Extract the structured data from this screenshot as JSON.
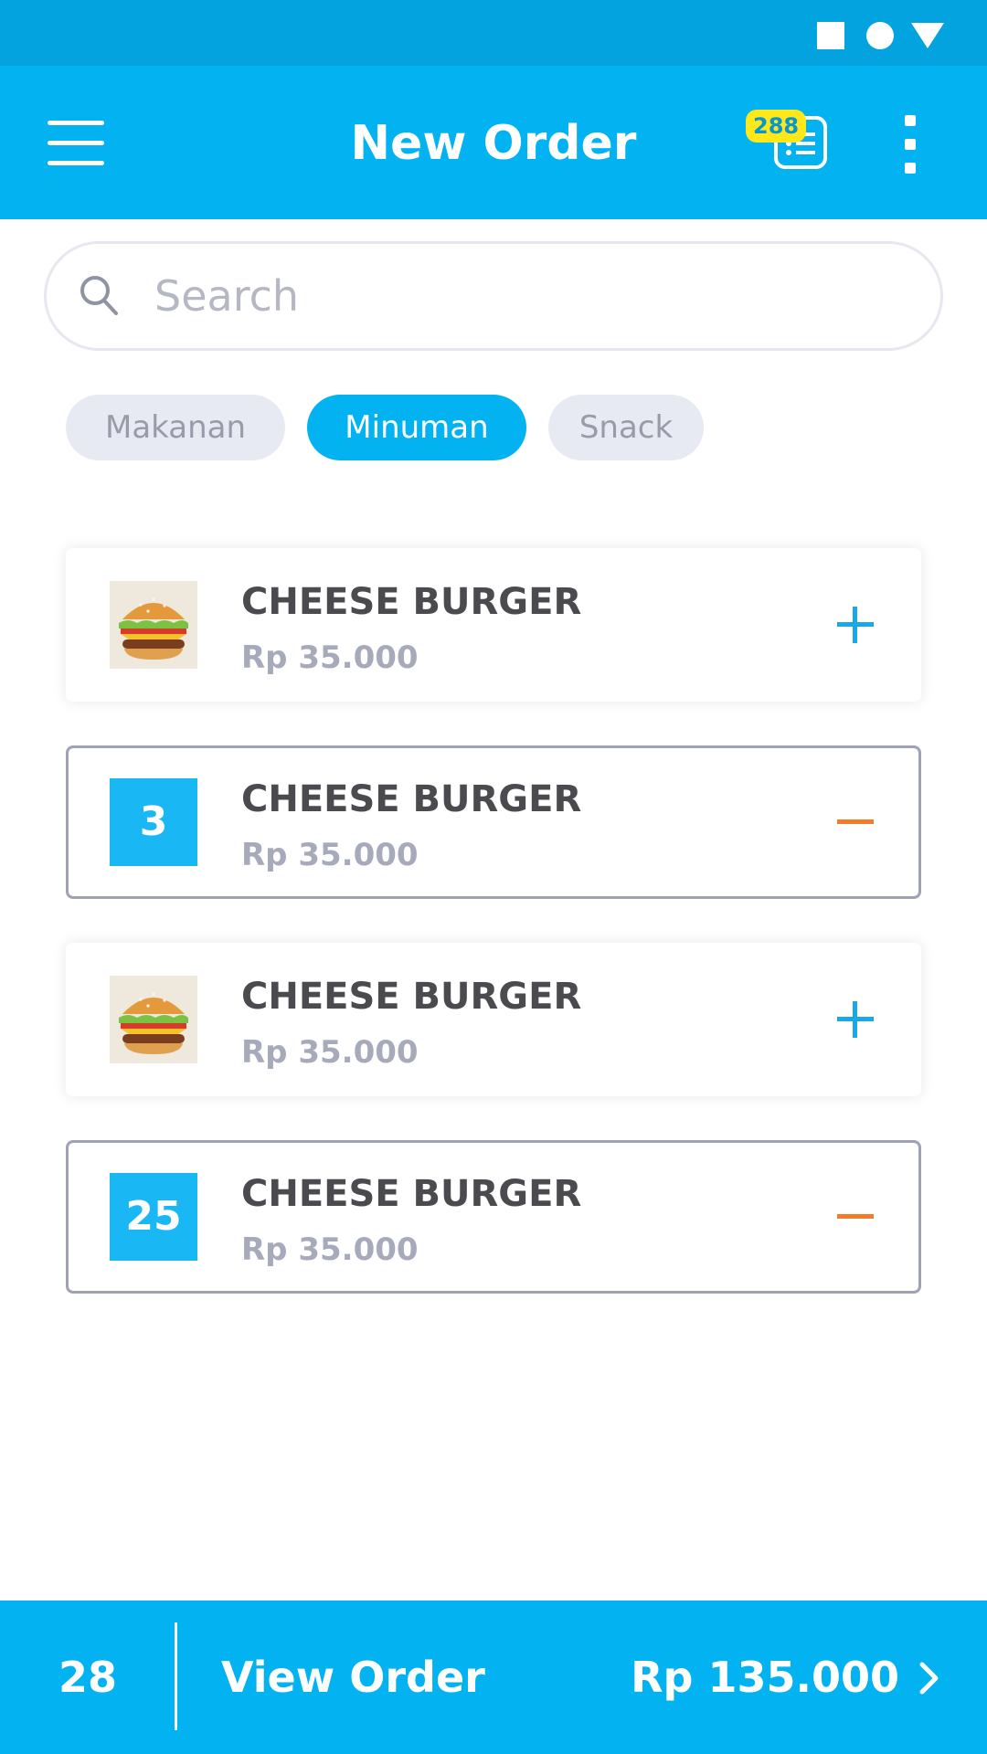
{
  "header": {
    "title": "New Order",
    "orders_badge": "288"
  },
  "search": {
    "placeholder": "Search",
    "value": ""
  },
  "categories": [
    {
      "label": "Makanan",
      "active": false
    },
    {
      "label": "Minuman",
      "active": true
    },
    {
      "label": "Snack",
      "active": false
    }
  ],
  "items": [
    {
      "name": "CHEESE BURGER",
      "price": "Rp 35.000",
      "selected": false,
      "action": "add"
    },
    {
      "name": "CHEESE BURGER",
      "price": "Rp 35.000",
      "selected": true,
      "quantity": "3",
      "action": "remove"
    },
    {
      "name": "CHEESE BURGER",
      "price": "Rp 35.000",
      "selected": false,
      "action": "add"
    },
    {
      "name": "CHEESE BURGER",
      "price": "Rp 35.000",
      "selected": true,
      "quantity": "25",
      "action": "remove"
    }
  ],
  "footer": {
    "count": "28",
    "label": "View Order",
    "total": "Rp 135.000"
  },
  "colors": {
    "primary": "#03b2f1",
    "status_bar": "#03a3df",
    "badge": "#ffe81a",
    "add_icon": "#1aa9e8",
    "remove_icon": "#f47a2c"
  },
  "icons": {
    "menu": "hamburger-menu-icon",
    "orders": "order-list-icon",
    "more": "more-vertical-icon",
    "search": "search-icon",
    "add": "plus-icon",
    "remove": "minus-icon",
    "next": "chevron-right-icon"
  }
}
